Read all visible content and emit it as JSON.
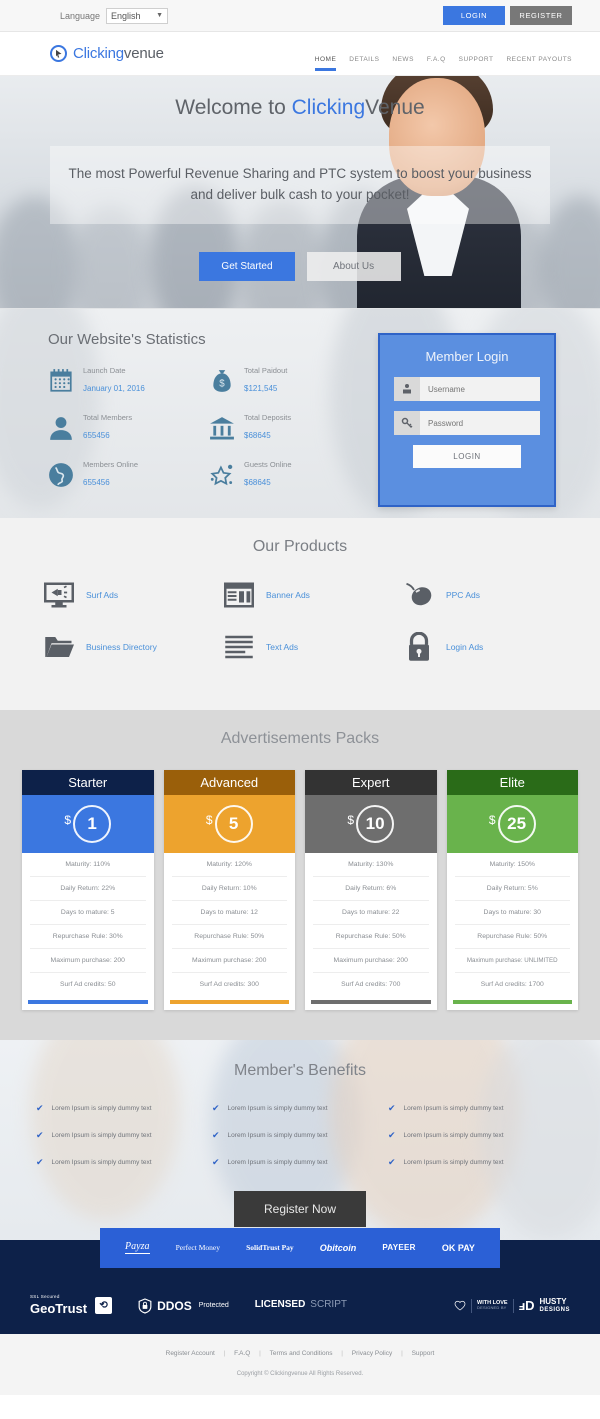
{
  "topbar": {
    "language_label": "Language",
    "language_value": "English",
    "login_label": "LOGIN",
    "register_label": "REGISTER"
  },
  "header": {
    "brand_part1": "Clicking",
    "brand_part2": "venue",
    "nav": [
      {
        "label": "HOME",
        "active": true
      },
      {
        "label": "DETAILS",
        "active": false
      },
      {
        "label": "NEWS",
        "active": false
      },
      {
        "label": "F.A.Q",
        "active": false
      },
      {
        "label": "SUPPORT",
        "active": false
      },
      {
        "label": "RECENT PAYOUTS",
        "active": false
      }
    ]
  },
  "hero": {
    "title_prefix": "Welcome to ",
    "title_highlight": "Clicking",
    "title_suffix": "Venue",
    "tagline": "The most Powerful Revenue Sharing and PTC system to boost your business and deliver bulk cash to your pocket!",
    "btn_primary": "Get Started",
    "btn_secondary": "About Us"
  },
  "stats": {
    "title": "Our Website's Statistics",
    "items": [
      {
        "icon": "calendar-icon",
        "label": "Launch Date",
        "value": "January 01, 2016"
      },
      {
        "icon": "money-bag-icon",
        "label": "Total Paidout",
        "value": "$121,545"
      },
      {
        "icon": "user-icon",
        "label": "Total Members",
        "value": "655456"
      },
      {
        "icon": "bank-icon",
        "label": "Total Deposits",
        "value": "$68645"
      },
      {
        "icon": "globe-icon",
        "label": "Members Online",
        "value": "655456"
      },
      {
        "icon": "star-icon",
        "label": "Guests Online",
        "value": "$68645"
      }
    ]
  },
  "member_login": {
    "title": "Member Login",
    "username_placeholder": "Username",
    "username_value": "",
    "password_placeholder": "Password",
    "password_value": "",
    "submit_label": "LOGIN"
  },
  "products": {
    "title": "Our Products",
    "items": [
      {
        "icon": "surf-ads-icon",
        "label": "Surf Ads"
      },
      {
        "icon": "banner-ads-icon",
        "label": "Banner Ads"
      },
      {
        "icon": "mouse-icon",
        "label": "PPC Ads"
      },
      {
        "icon": "folder-icon",
        "label": "Business Directory"
      },
      {
        "icon": "text-lines-icon",
        "label": "Text Ads"
      },
      {
        "icon": "lock-icon",
        "label": "Login Ads"
      }
    ]
  },
  "packs": {
    "title": "Advertisements Packs",
    "items": [
      {
        "name": "Starter",
        "currency": "$",
        "price": "1",
        "head_color": "#0d2149",
        "body_color": "#3b77e0",
        "bar_color": "#3b77e0",
        "features": [
          "Maturity: 110%",
          "Daily Return: 22%",
          "Days to mature: 5",
          "Repurchase Rule: 30%",
          "Maximum purchase: 200",
          "Surf Ad credits: 50"
        ]
      },
      {
        "name": "Advanced",
        "currency": "$",
        "price": "5",
        "head_color": "#9a5f0a",
        "body_color": "#eda32e",
        "bar_color": "#eda32e",
        "features": [
          "Maturity: 120%",
          "Daily Return: 10%",
          "Days to mature: 12",
          "Repurchase Rule: 50%",
          "Maximum purchase: 200",
          "Surf Ad credits: 300"
        ]
      },
      {
        "name": "Expert",
        "currency": "$",
        "price": "10",
        "head_color": "#333333",
        "body_color": "#6e6e6e",
        "bar_color": "#6e6e6e",
        "features": [
          "Maturity: 130%",
          "Daily Return: 6%",
          "Days to mature: 22",
          "Repurchase Rule: 50%",
          "Maximum purchase: 200",
          "Surf Ad credits: 700"
        ]
      },
      {
        "name": "Elite",
        "currency": "$",
        "price": "25",
        "head_color": "#2a6b18",
        "body_color": "#69b34c",
        "bar_color": "#69b34c",
        "features": [
          "Maturity: 150%",
          "Daily Return: 5%",
          "Days to mature: 30",
          "Repurchase Rule: 50%",
          "Maximum purchase: UNLIMITED",
          "Surf Ad credits: 1700"
        ]
      }
    ]
  },
  "benefits": {
    "title": "Member's Benefits",
    "columns": [
      [
        "Lorem Ipsum is simply dummy text",
        "Lorem Ipsum is simply dummy text",
        "Lorem Ipsum is simply dummy text"
      ],
      [
        "Lorem Ipsum is simply dummy text",
        "Lorem Ipsum is simply dummy text",
        "Lorem Ipsum is simply dummy text"
      ],
      [
        "Lorem Ipsum is simply dummy text",
        "Lorem Ipsum is simply dummy text",
        "Lorem Ipsum is simply dummy text"
      ]
    ],
    "register_label": "Register Now"
  },
  "payments": [
    {
      "name": "Payza"
    },
    {
      "name": "Perfect Money"
    },
    {
      "name": "SolidTrust Pay"
    },
    {
      "name": "Obitcoin"
    },
    {
      "name": "PAYEER"
    },
    {
      "name": "OK PAY"
    }
  ],
  "footer_badges": {
    "geotrust_top": "SSL Secured",
    "geotrust_name_1": "Geo",
    "geotrust_name_2": "Trust",
    "ddos_main": "DDOS",
    "ddos_sub": "Protected",
    "licensed_1": "LICENSED",
    "licensed_2": "SCRIPT",
    "with_love_1": "WITH LOVE",
    "with_love_2": "DESIGNED BY",
    "husty_1": "HUSTY",
    "husty_2": "DESIGNS"
  },
  "footer": {
    "links": [
      "Register Account",
      "F.A.Q",
      "Terms and Conditions",
      "Privacy Policy",
      "Support"
    ],
    "copyright": "Copyright © Clickingvenue All Rights Reserved."
  }
}
